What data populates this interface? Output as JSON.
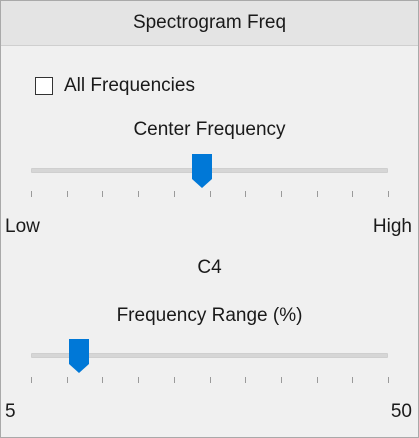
{
  "panel": {
    "title": "Spectrogram Freq",
    "all_frequencies": {
      "label": "All Frequencies",
      "checked": false
    },
    "center_frequency": {
      "label": "Center Frequency",
      "min_label": "Low",
      "max_label": "High",
      "value_fraction": 0.48,
      "tick_count": 11,
      "readout": "C4"
    },
    "frequency_range": {
      "label": "Frequency Range (%)",
      "min_label": "5",
      "max_label": "50",
      "min": 5,
      "max": 50,
      "value": 11,
      "tick_count": 11
    }
  },
  "colors": {
    "accent": "#0078d7",
    "panel_bg": "#f0f0f0",
    "header_bg": "#e4e4e4"
  }
}
